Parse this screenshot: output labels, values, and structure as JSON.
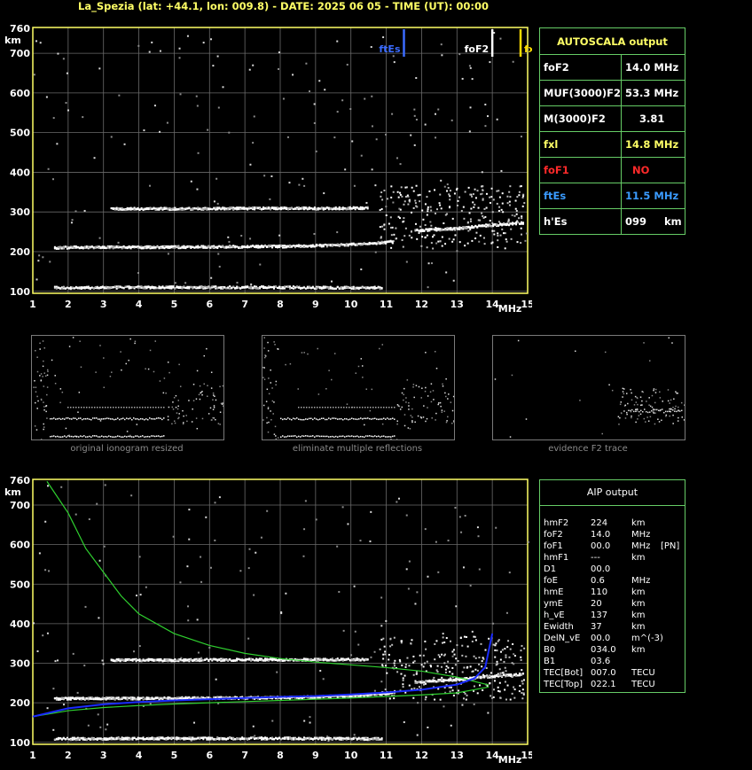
{
  "header": "La_Spezia (lat: +44.1, lon: 009.8) - DATE: 2025 06 05 - TIME (UT): 00:00",
  "colors": {
    "axis": "#ffff66",
    "grid": "#6a6a6a",
    "panel_border": "#66cc66",
    "ftEs": "#3a6bff",
    "foF2": "#ffffff",
    "fxl": "#ffdd00",
    "foF1": "#ff2a2a",
    "label_white": "#ffffff",
    "label_yellow": "#ffff66",
    "profile_green": "#2fd02f",
    "profile_blue": "#1a2bff",
    "caption": "#8a8a8a"
  },
  "chart_data": [
    {
      "type": "scatter",
      "name": "ionogram-top",
      "x_ticks": [
        1,
        2,
        3,
        4,
        5,
        6,
        7,
        8,
        9,
        10,
        11,
        12,
        13,
        14,
        15
      ],
      "y_ticks": [
        100,
        200,
        300,
        400,
        500,
        600,
        700
      ],
      "y_top_label": "760",
      "y_unit": "km",
      "x_unit": "MHz",
      "xlim": [
        1,
        15
      ],
      "ylim": [
        95,
        765
      ],
      "markers": [
        {
          "label": "ftEs",
          "freq": 11.5,
          "color": "#3a6bff"
        },
        {
          "label": "foF2",
          "freq": 14.0,
          "color": "#ffffff"
        },
        {
          "label": "fxl",
          "freq": 14.8,
          "color": "#ffdd00"
        }
      ],
      "traces": [
        {
          "name": "Es trace",
          "x": [
            1.6,
            2.5,
            4,
            6,
            8,
            10,
            10.9
          ],
          "y": [
            111,
            111,
            112,
            112,
            112,
            111,
            111
          ]
        },
        {
          "name": "F trace",
          "x": [
            1.6,
            2.5,
            4,
            6,
            8,
            9.5,
            10.5,
            11.2
          ],
          "y": [
            212,
            213,
            213,
            214,
            215,
            218,
            222,
            228
          ]
        },
        {
          "name": "F high",
          "x": [
            11.8,
            12.5,
            13.2,
            13.8,
            14.5,
            14.9
          ],
          "y": [
            255,
            258,
            262,
            268,
            272,
            275
          ]
        },
        {
          "name": "Es 2-hop",
          "x": [
            3.2,
            5,
            7,
            9,
            10.5
          ],
          "y": [
            310,
            310,
            311,
            311,
            312
          ]
        }
      ]
    },
    {
      "type": "line",
      "name": "ionogram-profile",
      "x_ticks": [
        1,
        2,
        3,
        4,
        5,
        6,
        7,
        8,
        9,
        10,
        11,
        12,
        13,
        14,
        15
      ],
      "y_ticks": [
        100,
        200,
        300,
        400,
        500,
        600,
        700
      ],
      "y_top_label": "760",
      "y_unit": "km",
      "x_unit": "MHz",
      "xlim": [
        1,
        15
      ],
      "ylim": [
        95,
        765
      ],
      "series": [
        {
          "name": "green-upper",
          "x": [
            1.4,
            2,
            2.5,
            3,
            3.5,
            4,
            5,
            6,
            7,
            8,
            9,
            10,
            11,
            12,
            13,
            13.9
          ],
          "y": [
            760,
            680,
            590,
            530,
            470,
            425,
            375,
            345,
            325,
            312,
            303,
            296,
            289,
            280,
            265,
            245
          ]
        },
        {
          "name": "green-lower",
          "x": [
            1,
            2,
            3,
            4,
            5,
            6,
            7,
            8,
            9,
            10,
            11,
            12,
            13,
            13.9
          ],
          "y": [
            165,
            180,
            188,
            193,
            197,
            200,
            203,
            206,
            209,
            212,
            216,
            220,
            225,
            240
          ]
        },
        {
          "name": "blue-profile",
          "x": [
            1,
            2,
            3,
            4,
            5,
            6,
            7,
            8,
            9,
            10,
            11,
            12,
            13,
            13.5,
            13.8,
            14.0
          ],
          "y": [
            165,
            186,
            196,
            202,
            206,
            209,
            212,
            215,
            217,
            221,
            226,
            233,
            246,
            262,
            290,
            375
          ]
        }
      ]
    }
  ],
  "autoscala": {
    "title": "AUTOSCALA output",
    "rows": [
      {
        "label": "foF2",
        "value": "14.0 MHz",
        "color": "#ffffff"
      },
      {
        "label": "MUF(3000)F2",
        "value": "53.3 MHz",
        "color": "#ffffff"
      },
      {
        "label": "M(3000)F2",
        "value": "3.81",
        "color": "#ffffff"
      },
      {
        "label": "fxl",
        "value": "14.8 MHz",
        "color": "#ffff66"
      },
      {
        "label": "foF1",
        "value": "NO",
        "color": "#ff2a2a"
      },
      {
        "label": "ftEs",
        "value": "11.5 MHz",
        "color": "#3a9bff"
      },
      {
        "label": "h'Es",
        "value": "099     km",
        "color": "#ffffff"
      }
    ]
  },
  "captions": [
    "original ionogram resized",
    "eliminate multiple reflections",
    "evidence F2 trace"
  ],
  "aip": {
    "title": "AIP output",
    "rows": [
      [
        "hmF2",
        "224",
        "km",
        ""
      ],
      [
        "foF2",
        "14.0",
        "MHz",
        ""
      ],
      [
        "foF1",
        "00.0",
        "MHz",
        "[PN]"
      ],
      [
        "hmF1",
        "---",
        "km",
        ""
      ],
      [
        "D1",
        "00.0",
        "",
        ""
      ],
      [
        "foE",
        "0.6",
        "MHz",
        ""
      ],
      [
        "hmE",
        "110",
        "km",
        ""
      ],
      [
        "ymE",
        "20",
        "km",
        ""
      ],
      [
        "h_vE",
        "137",
        "km",
        ""
      ],
      [
        "Ewidth",
        "37",
        "km",
        ""
      ],
      [
        "DelN_vE",
        "00.0",
        "m^(-3)",
        ""
      ],
      [
        "B0",
        "034.0",
        "km",
        ""
      ],
      [
        "B1",
        "03.6",
        "",
        ""
      ],
      [
        "TEC[Bot]",
        "007.0",
        "TECU",
        ""
      ],
      [
        "TEC[Top]",
        "022.1",
        "TECU",
        ""
      ]
    ]
  }
}
